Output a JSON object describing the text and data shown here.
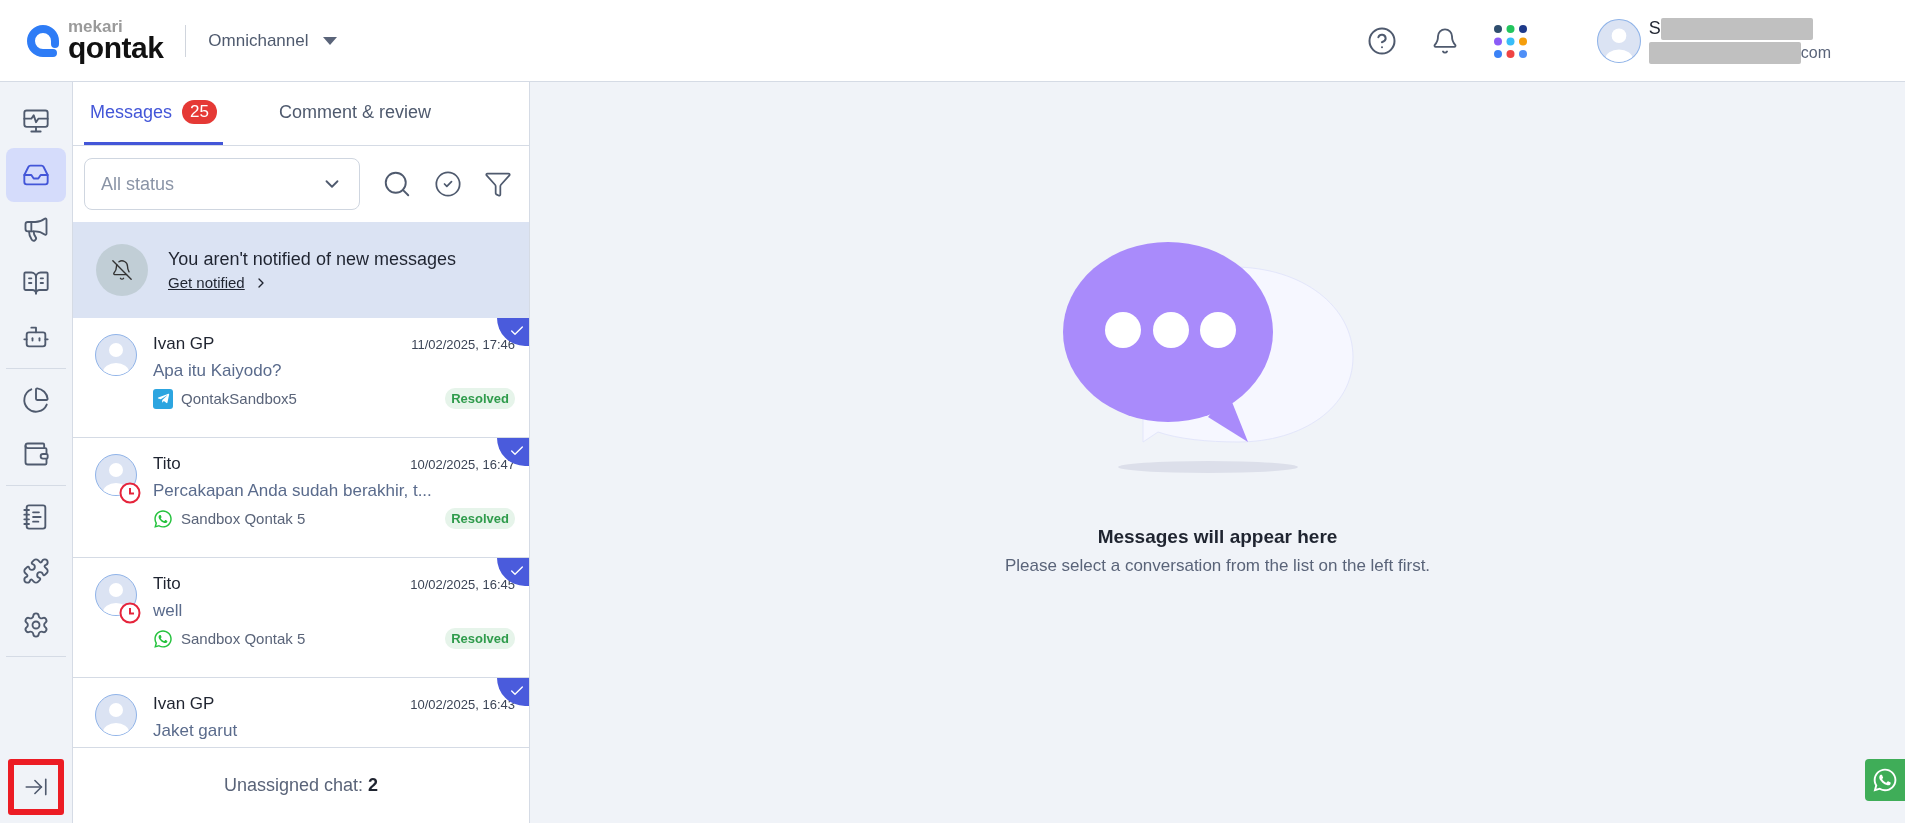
{
  "header": {
    "logo": {
      "top": "mekari",
      "bottom": "qontak"
    },
    "app_switcher": {
      "label": "Omnichannel"
    },
    "user": {
      "name_visible": "S",
      "email_visible": "com"
    }
  },
  "sidebar": {
    "groups": [
      {
        "items": [
          {
            "selected": false
          },
          {
            "selected": true
          },
          {
            "selected": false
          },
          {
            "selected": false
          },
          {
            "selected": false
          }
        ]
      },
      {
        "items": [
          {
            "selected": false
          },
          {
            "selected": false
          }
        ]
      },
      {
        "items": [
          {
            "selected": false
          },
          {
            "selected": false
          },
          {
            "selected": false
          }
        ]
      }
    ],
    "collapse": {
      "highlighted": true
    }
  },
  "tabs": [
    {
      "label": "Messages",
      "badge": "25",
      "selected": true
    },
    {
      "label": "Comment & review",
      "selected": false
    }
  ],
  "filter": {
    "placeholder": "All status"
  },
  "notice": {
    "text": "You aren't notified of new messages",
    "link": "Get notified"
  },
  "chats": [
    {
      "name": "Ivan GP",
      "time": "11/02/2025, 17:46",
      "preview": "Apa itu Kaiyodo?",
      "channel": {
        "kind": "telegram",
        "name": "QontakSandbox5"
      },
      "status": "Resolved",
      "overdue": false,
      "checked": true
    },
    {
      "name": "Tito",
      "time": "10/02/2025, 16:47",
      "preview": "Percakapan Anda sudah berakhir, t...",
      "channel": {
        "kind": "whatsapp",
        "name": "Sandbox Qontak 5"
      },
      "status": "Resolved",
      "overdue": true,
      "checked": true
    },
    {
      "name": "Tito",
      "time": "10/02/2025, 16:45",
      "preview": "well",
      "channel": {
        "kind": "whatsapp",
        "name": "Sandbox Qontak 5"
      },
      "status": "Resolved",
      "overdue": true,
      "checked": true
    },
    {
      "name": "Ivan GP",
      "time": "10/02/2025, 16:43",
      "preview": "Jaket garut",
      "overdue": false,
      "checked": true
    }
  ],
  "footer": {
    "text": "Unassigned chat: **2**"
  },
  "empty_state": {
    "title": "Messages will appear here",
    "subtitle": "Please select a conversation from the list on the left first."
  }
}
